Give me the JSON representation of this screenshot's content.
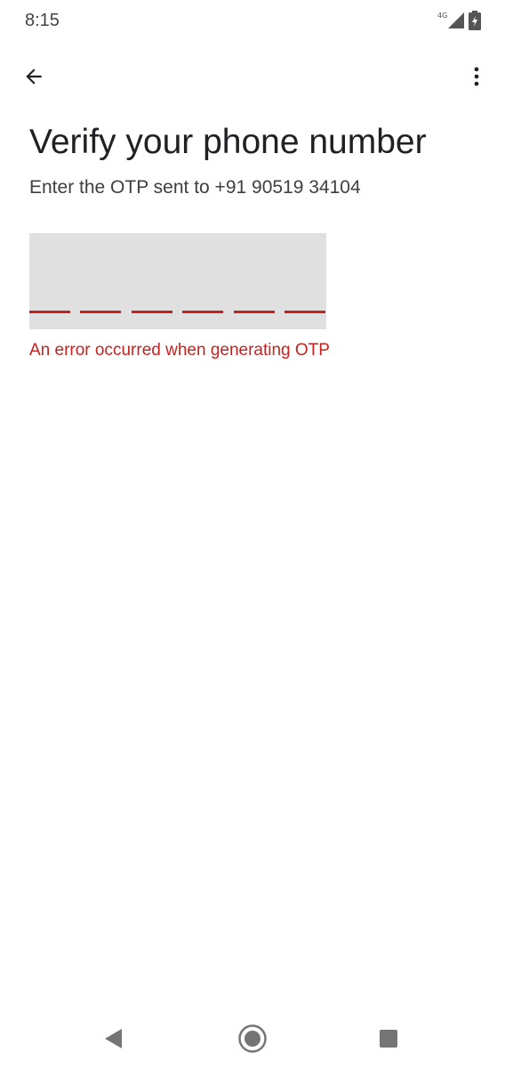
{
  "status_bar": {
    "time": "8:15",
    "network_type": "4G",
    "icons": [
      "signal-icon",
      "battery-icon"
    ]
  },
  "app_bar": {
    "back_icon": "arrow-back-icon",
    "more_icon": "more-vert-icon"
  },
  "content": {
    "title": "Verify your phone number",
    "subtitle": "Enter the OTP sent to +91 90519 34104",
    "otp_length": 6,
    "error_message": "An error occurred when generating OTP"
  },
  "nav_bar": {
    "icons": [
      "nav-back-icon",
      "nav-home-icon",
      "nav-recents-icon"
    ]
  },
  "colors": {
    "error": "#c5221f",
    "field_background": "#e0e0e0",
    "title_text": "#202124",
    "body_text": "#3c4043"
  }
}
